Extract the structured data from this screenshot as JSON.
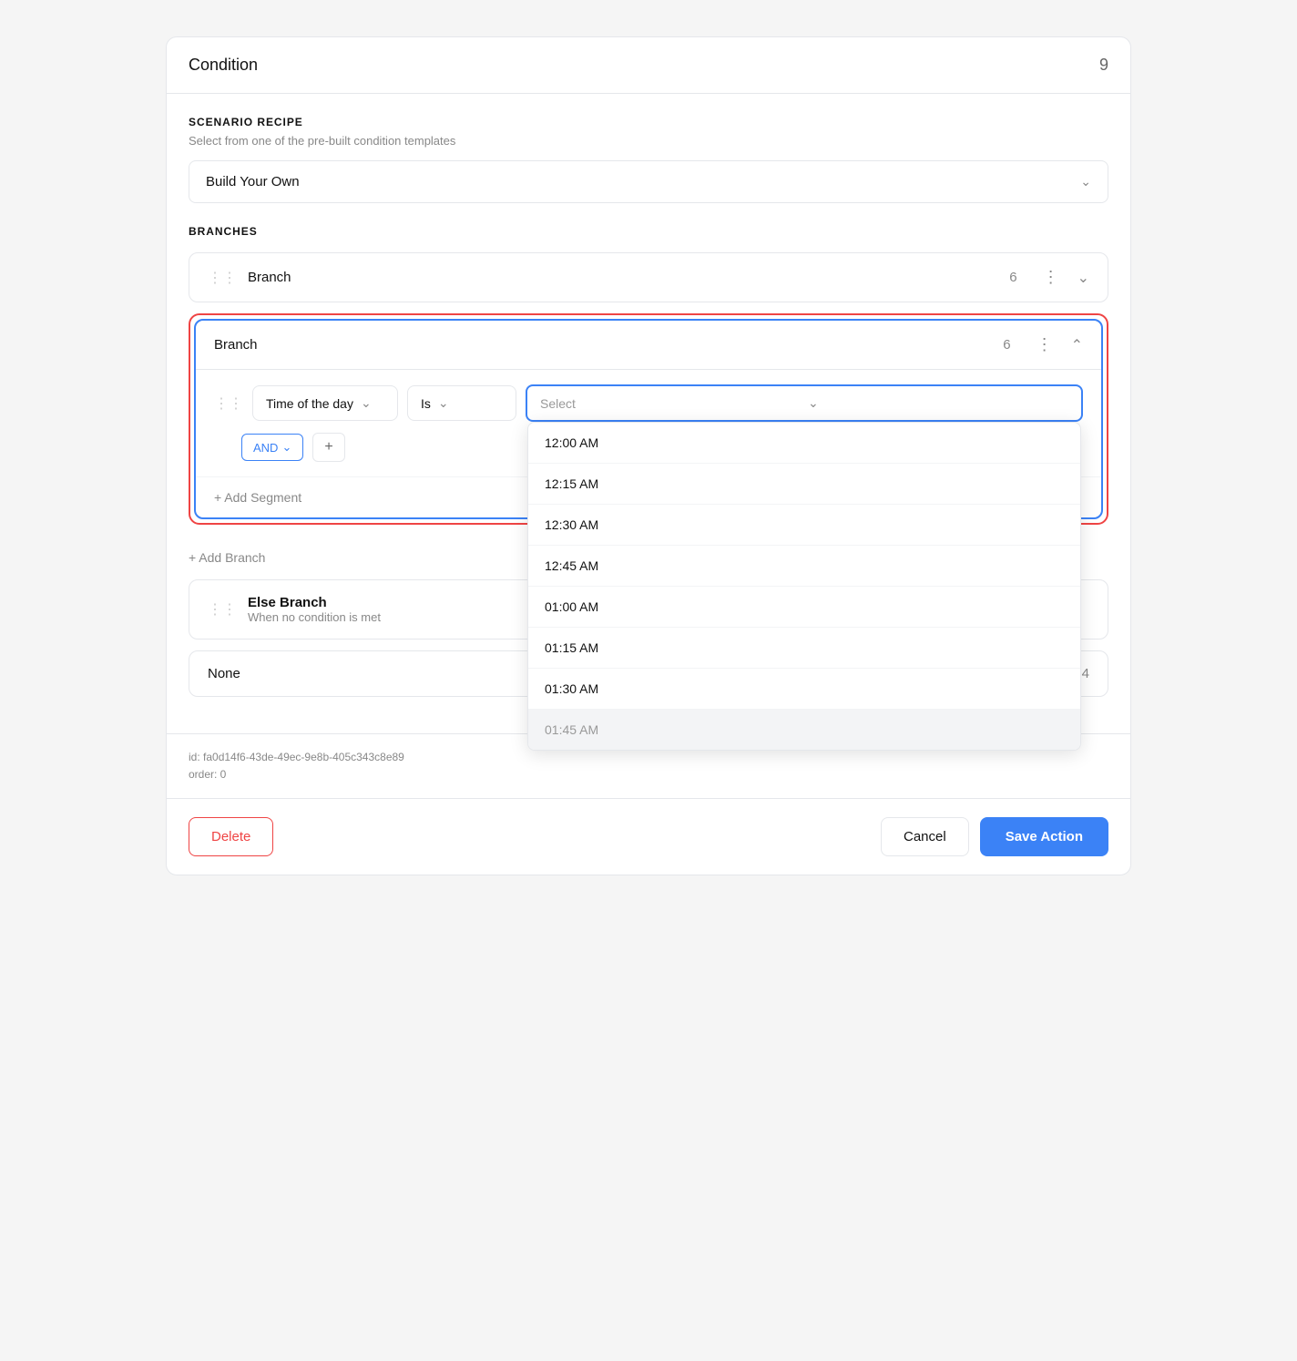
{
  "page": {
    "condition_label": "Condition",
    "condition_number": "9"
  },
  "scenario_recipe": {
    "title": "SCENARIO RECIPE",
    "subtitle": "Select from one of the pre-built condition templates",
    "selected": "Build Your Own"
  },
  "branches": {
    "title": "BRANCHES",
    "branch1": {
      "name": "Branch",
      "number": "6"
    },
    "branch2": {
      "name": "Branch",
      "number": "6"
    }
  },
  "condition": {
    "field": "Time of the day",
    "operator": "Is",
    "value_placeholder": "Select",
    "and_label": "AND",
    "add_segment_label": "+ Add Segment"
  },
  "time_options": [
    "12:00 AM",
    "12:15 AM",
    "12:30 AM",
    "12:45 AM",
    "01:00 AM",
    "01:15 AM",
    "01:30 AM",
    "01:45 AM"
  ],
  "add_branch_label": "+ Add Branch",
  "else_branch": {
    "title": "Else Branch",
    "subtitle": "When no condition is met"
  },
  "none_label": "None",
  "none_number": "4",
  "meta": {
    "id_label": "id: fa0d14f6-43de-49ec-9e8b-405c343c8e89",
    "order_label": "order: 0"
  },
  "footer": {
    "delete_label": "Delete",
    "cancel_label": "Cancel",
    "save_label": "Save Action"
  }
}
